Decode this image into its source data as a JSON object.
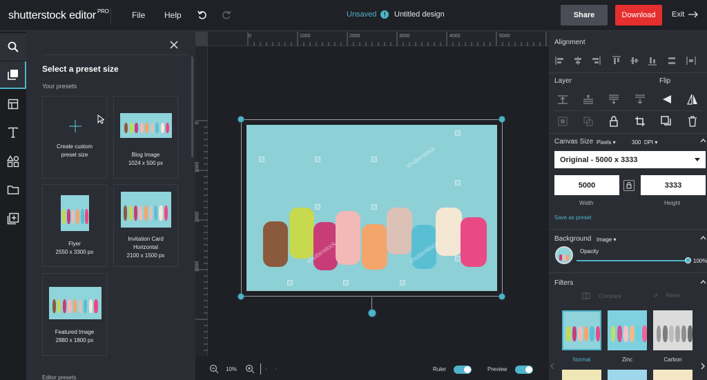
{
  "app": {
    "name": "shutterstock editor",
    "badge": "PRO"
  },
  "menu": {
    "file": "File",
    "help": "Help"
  },
  "status": {
    "label": "Unsaved",
    "info": "!"
  },
  "document": {
    "title": "Untitled design"
  },
  "actions": {
    "share": "Share",
    "download": "Download",
    "exit": "Exit"
  },
  "sidebar": {
    "items": [
      "search-icon",
      "layers-icon",
      "layout-icon",
      "text-icon",
      "elements-icon",
      "folder-icon",
      "add-image-icon"
    ]
  },
  "presets": {
    "heading": "Select a preset size",
    "your_presets": "Your presets",
    "editor_presets": "Editor presets",
    "cards": [
      {
        "line1": "Create custom",
        "line2": "preset size"
      },
      {
        "line1": "Blog Image",
        "line2": "1024 x 500 px"
      },
      {
        "line1": "Flyer",
        "line2": "2550 x 3300 px"
      },
      {
        "line1": "Invitation Card",
        "line2": "Horizontal",
        "line3": "2100 x 1500 px"
      },
      {
        "line1": "Featured Image",
        "line2": "2880 x 1800 px"
      }
    ]
  },
  "rulers": {
    "top": [
      "0",
      "1000",
      "2000",
      "3000",
      "4000",
      "5000"
    ],
    "left": [
      "0",
      "1000",
      "2000",
      "3000"
    ]
  },
  "canvas": {
    "watermark": "shutterstock"
  },
  "zoom": {
    "value": "10%"
  },
  "toggles": {
    "ruler": "Ruler",
    "preview": "Preview"
  },
  "right": {
    "alignment": "Alignment",
    "layer": "Layer",
    "flip": "Flip",
    "canvas_size": "Canvas Size",
    "unit": "Pixels",
    "dpi_value": "300",
    "dpi_label": "DPI",
    "size_preset": "Original - 5000 x 3333",
    "width_value": "5000",
    "height_value": "3333",
    "width_label": "Width",
    "height_label": "Height",
    "save_preset": "Save as preset",
    "background": "Background",
    "bg_type": "Image",
    "opacity_label": "Opacity",
    "opacity_value": "100%",
    "filters": "Filters",
    "compare": "Compare",
    "reset": "Reset",
    "filter_names": [
      "Normal",
      "Zinc",
      "Carbon"
    ]
  },
  "colors": {
    "accent": "#4fb3c9",
    "download": "#e52e2e",
    "photo_bg": "#8dd0d6"
  }
}
